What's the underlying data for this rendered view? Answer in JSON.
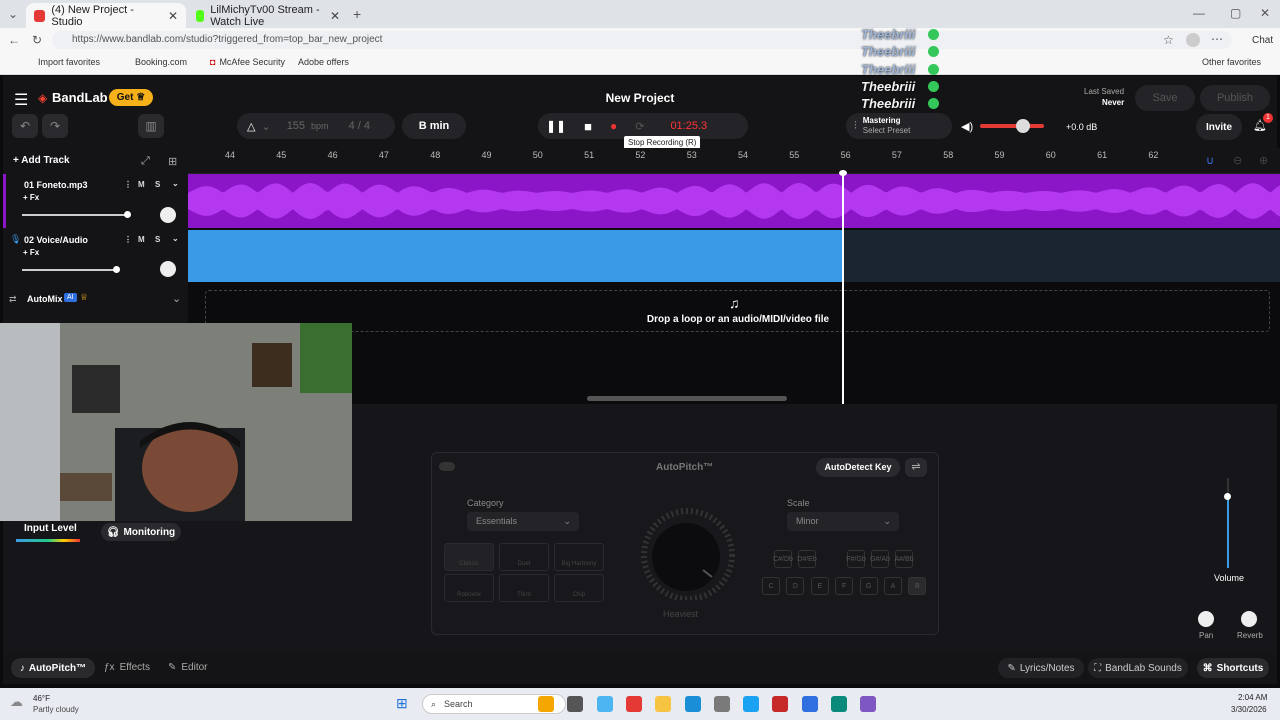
{
  "browser": {
    "tabs": [
      {
        "label": "(4) New Project - Studio"
      },
      {
        "label": "LilMichyTv00 Stream - Watch Live"
      }
    ],
    "url": "https://www.bandlab.com/studio?triggered_from=top_bar_new_project",
    "favorites": [
      "Import favorites",
      "Booking.com",
      "McAfee Security",
      "Adobe offers"
    ],
    "other_favorites": "Other favorites",
    "chat": "Chat"
  },
  "overlay": {
    "names": [
      "Theebriii",
      "Theebriii",
      "Theebriii",
      "Theebriii",
      "Theebriii"
    ]
  },
  "app": {
    "brand": "BandLab",
    "get": "Get",
    "project_title": "New Project",
    "bpm": "155",
    "bpm_unit": "bpm",
    "time_sig": "4 / 4",
    "key": "B min",
    "time": "01:25.3",
    "tooltip": "Stop Recording (R)",
    "mastering": "Mastering",
    "select_preset": "Select Preset",
    "volume_db": "+0.0 dB",
    "last_saved_label": "Last Saved",
    "last_saved_value": "Never",
    "save": "Save",
    "publish": "Publish",
    "invite": "Invite",
    "notif_count": "1"
  },
  "timeline": {
    "add_track": "Add Track",
    "ticks": [
      "44",
      "45",
      "46",
      "47",
      "48",
      "49",
      "50",
      "51",
      "52",
      "53",
      "54",
      "55",
      "56",
      "57",
      "58",
      "59",
      "60",
      "61",
      "62"
    ],
    "tracks": [
      {
        "name": "01  Foneto.mp3",
        "fx": "+ Fx"
      },
      {
        "name": "02  Voice/Audio",
        "fx": "+ Fx"
      }
    ],
    "m": "M",
    "s": "S",
    "automix": "AutoMix",
    "ai": "AI",
    "drop_text": "Drop a loop or an audio/MIDI/video file"
  },
  "cam": {
    "input_level": "Input Level",
    "monitoring": "Monitoring"
  },
  "autopitch": {
    "title": "AutoPitch™",
    "autodetect": "AutoDetect Key",
    "category_label": "Category",
    "category_value": "Essentials",
    "scale_label": "Scale",
    "scale_value": "Minor",
    "presets": [
      "Classic",
      "Duet",
      "Big Harmony",
      "Robovox",
      "Third",
      "Chip"
    ],
    "knob_label": "Heaviest",
    "keys_top": [
      "C#/Db",
      "D#/Eb",
      "F#/Gb",
      "G#/Ab",
      "A#/Bb"
    ],
    "keys_bottom": [
      "C",
      "D",
      "E",
      "F",
      "G",
      "A",
      "B"
    ],
    "volume": "Volume",
    "pan": "Pan",
    "reverb": "Reverb"
  },
  "bottombar": {
    "autopitch": "AutoPitch™",
    "effects": "Effects",
    "editor": "Editor",
    "lyrics": "Lyrics/Notes",
    "sounds": "BandLab Sounds",
    "shortcuts": "Shortcuts"
  },
  "taskbar": {
    "temp": "46°F",
    "weather": "Partly cloudy",
    "search": "Search",
    "time": "2:04 AM",
    "date": "3/30/2026"
  }
}
